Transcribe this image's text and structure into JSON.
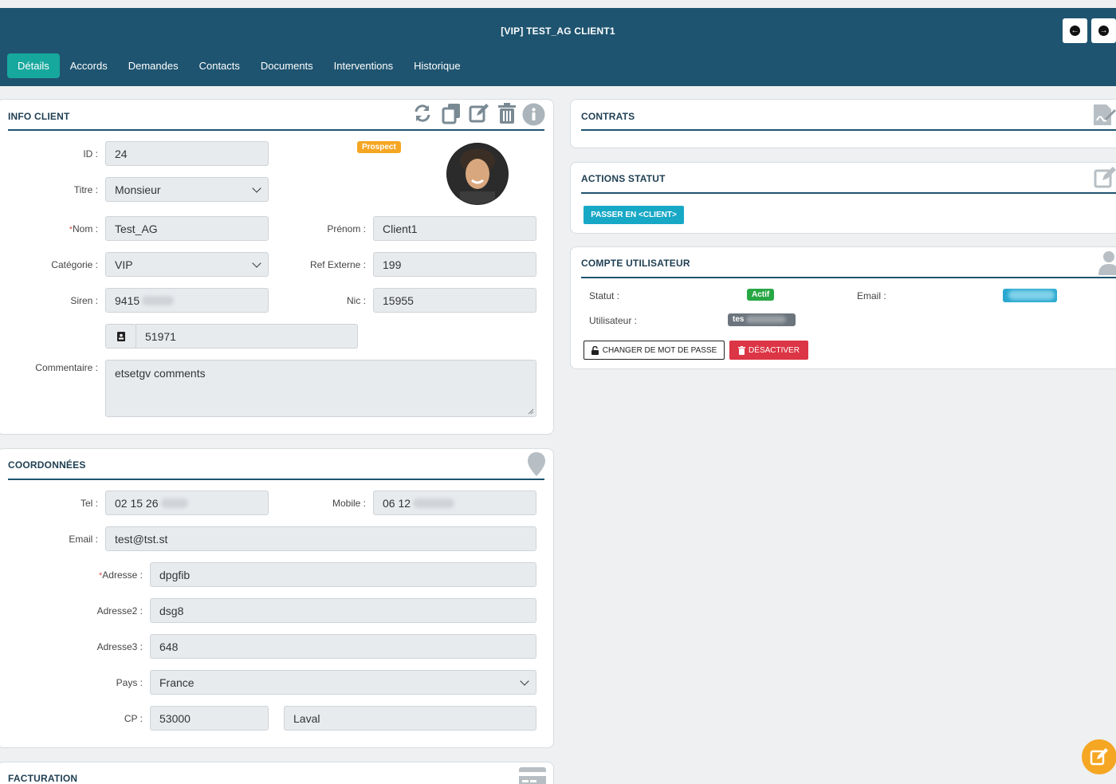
{
  "header": {
    "title": "[VIP] TEST_AG CLIENT1",
    "tabs": [
      "Détails",
      "Accords",
      "Demandes",
      "Contacts",
      "Documents",
      "Interventions",
      "Historique"
    ]
  },
  "info_client": {
    "title": "INFO CLIENT",
    "badge": "Prospect",
    "id_label": "ID :",
    "id_value": "24",
    "titre_label": "Titre :",
    "titre_value": "Monsieur",
    "nom_label": "Nom :",
    "nom_value": "Test_AG",
    "prenom_label": "Prénom :",
    "prenom_value": "Client1",
    "categorie_label": "Catégorie :",
    "categorie_value": "VIP",
    "ref_label": "Ref Externe :",
    "ref_value": "199",
    "siren_label": "Siren :",
    "siren_value": "9415",
    "nic_label": "Nic :",
    "nic_value": "15955",
    "code_value": "51971",
    "commentaire_label": "Commentaire :",
    "commentaire_value": "etsetgv comments"
  },
  "coordonnees": {
    "title": "COORDONNÉES",
    "tel_label": "Tel :",
    "tel_value": "02 15 26",
    "mobile_label": "Mobile :",
    "mobile_value": "06 12",
    "email_label": "Email :",
    "email_value": "test@tst.st",
    "adresse_label": "Adresse :",
    "adresse_value": "dpgfib",
    "adresse2_label": "Adresse2 :",
    "adresse2_value": "dsg8",
    "adresse3_label": "Adresse3 :",
    "adresse3_value": "648",
    "pays_label": "Pays :",
    "pays_value": "France",
    "cp_label": "CP :",
    "cp_value": "53000",
    "ville_value": "Laval"
  },
  "facturation": {
    "title": "FACTURATION"
  },
  "contrats": {
    "title": "CONTRATS"
  },
  "actions_statut": {
    "title": "ACTIONS STATUT",
    "button": "PASSER EN <CLIENT>"
  },
  "compte": {
    "title": "COMPTE UTILISATEUR",
    "statut_label": "Statut :",
    "statut_badge": "Actif",
    "email_label": "Email :",
    "user_label": "Utilisateur :",
    "user_value": "tes",
    "change_pwd": "CHANGER DE MOT DE PASSE",
    "deactivate": "DÉSACTIVER"
  },
  "colors": {
    "header": "#1e5470",
    "active_tab": "#17a89d",
    "prospect": "#f5a623",
    "actif": "#28a745",
    "danger": "#dc3545",
    "action": "#17a8c6",
    "fab": "#f5a623"
  }
}
